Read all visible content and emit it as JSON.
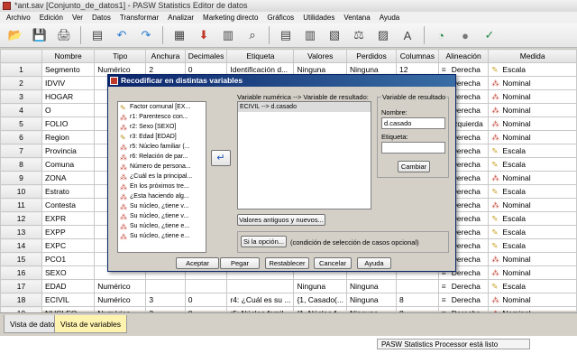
{
  "window": {
    "title": "*ant.sav [Conjunto_de_datos1] - PASW Statistics Editor de datos"
  },
  "menu": [
    "Archivo",
    "Edición",
    "Ver",
    "Datos",
    "Transformar",
    "Analizar",
    "Marketing directo",
    "Gráficos",
    "Utilidades",
    "Ventana",
    "Ayuda"
  ],
  "toolbar_icons": [
    "open-folder-icon",
    "save-icon",
    "print-icon",
    "dialog-recall-icon",
    "undo-icon",
    "redo-icon",
    "goto-case-icon",
    "goto-variable-icon",
    "variables-icon",
    "find-icon",
    "insert-cases-icon",
    "insert-variable-icon",
    "split-file-icon",
    "weight-cases-icon",
    "select-cases-icon",
    "value-labels-icon",
    "use-sets-icon",
    "show-all-variables-icon",
    "spell-check-icon"
  ],
  "columns": [
    "",
    "Nombre",
    "Tipo",
    "Anchura",
    "Decimales",
    "Etiqueta",
    "Valores",
    "Perdidos",
    "Columnas",
    "Alineación",
    "Medida"
  ],
  "rows": [
    {
      "n": "1",
      "name": "Segmento",
      "type": "Numérico",
      "width": "2",
      "dec": "0",
      "label": "Identificación d...",
      "values": "Ninguna",
      "missing": "Ninguna",
      "cols": "12",
      "align": "Derecha",
      "measure": "Escala",
      "mtype": "scale"
    },
    {
      "n": "2",
      "name": "IDVIV",
      "type": "",
      "width": "",
      "dec": "",
      "label": "",
      "values": "",
      "missing": "",
      "cols": "",
      "align": "Derecha",
      "measure": "Nominal",
      "mtype": "nominal"
    },
    {
      "n": "3",
      "name": "HOGAR",
      "type": "",
      "width": "",
      "dec": "",
      "label": "",
      "values": "",
      "missing": "",
      "cols": "",
      "align": "Derecha",
      "measure": "Nominal",
      "mtype": "nominal"
    },
    {
      "n": "4",
      "name": "O",
      "type": "",
      "width": "",
      "dec": "",
      "label": "",
      "values": "",
      "missing": "",
      "cols": "",
      "align": "Derecha",
      "measure": "Nominal",
      "mtype": "nominal"
    },
    {
      "n": "5",
      "name": "FOLIO",
      "type": "",
      "width": "",
      "dec": "",
      "label": "",
      "values": "",
      "missing": "",
      "cols": "",
      "align": "Izquierda",
      "measure": "Nominal",
      "mtype": "nominal"
    },
    {
      "n": "6",
      "name": "Region",
      "type": "",
      "width": "",
      "dec": "",
      "label": "",
      "values": "",
      "missing": "",
      "cols": "",
      "align": "Derecha",
      "measure": "Nominal",
      "mtype": "nominal"
    },
    {
      "n": "7",
      "name": "Provincia",
      "type": "",
      "width": "",
      "dec": "",
      "label": "",
      "values": "",
      "missing": "",
      "cols": "",
      "align": "Derecha",
      "measure": "Escala",
      "mtype": "scale"
    },
    {
      "n": "8",
      "name": "Comuna",
      "type": "",
      "width": "",
      "dec": "",
      "label": "",
      "values": "",
      "missing": "",
      "cols": "",
      "align": "Derecha",
      "measure": "Escala",
      "mtype": "scale"
    },
    {
      "n": "9",
      "name": "ZONA",
      "type": "",
      "width": "",
      "dec": "",
      "label": "",
      "values": "",
      "missing": "",
      "cols": "",
      "align": "Derecha",
      "measure": "Nominal",
      "mtype": "nominal"
    },
    {
      "n": "10",
      "name": "Estrato",
      "type": "",
      "width": "",
      "dec": "",
      "label": "",
      "values": "",
      "missing": "",
      "cols": "",
      "align": "Derecha",
      "measure": "Escala",
      "mtype": "scale"
    },
    {
      "n": "11",
      "name": "Contesta",
      "type": "",
      "width": "",
      "dec": "",
      "label": "",
      "values": "",
      "missing": "",
      "cols": "",
      "align": "Derecha",
      "measure": "Nominal",
      "mtype": "nominal"
    },
    {
      "n": "12",
      "name": "EXPR",
      "type": "",
      "width": "",
      "dec": "",
      "label": "",
      "values": "",
      "missing": "",
      "cols": "",
      "align": "Derecha",
      "measure": "Escala",
      "mtype": "scale"
    },
    {
      "n": "13",
      "name": "EXPP",
      "type": "",
      "width": "",
      "dec": "",
      "label": "",
      "values": "",
      "missing": "",
      "cols": "",
      "align": "Derecha",
      "measure": "Escala",
      "mtype": "scale"
    },
    {
      "n": "14",
      "name": "EXPC",
      "type": "",
      "width": "",
      "dec": "",
      "label": "",
      "values": "",
      "missing": "",
      "cols": "",
      "align": "Derecha",
      "measure": "Escala",
      "mtype": "scale"
    },
    {
      "n": "15",
      "name": "PCO1",
      "type": "",
      "width": "",
      "dec": "",
      "label": "",
      "values": "",
      "missing": "",
      "cols": "",
      "align": "Derecha",
      "measure": "Nominal",
      "mtype": "nominal"
    },
    {
      "n": "16",
      "name": "SEXO",
      "type": "",
      "width": "",
      "dec": "",
      "label": "",
      "values": "",
      "missing": "",
      "cols": "",
      "align": "Derecha",
      "measure": "Nominal",
      "mtype": "nominal"
    },
    {
      "n": "17",
      "name": "EDAD",
      "type": "Numérico",
      "width": "",
      "dec": "",
      "label": "",
      "values": "Ninguna",
      "missing": "Ninguna",
      "cols": "",
      "align": "Derecha",
      "measure": "Escala",
      "mtype": "scale"
    },
    {
      "n": "18",
      "name": "ECIVIL",
      "type": "Numérico",
      "width": "3",
      "dec": "0",
      "label": "r4: ¿Cuál es su ...",
      "values": "{1, Casado(...",
      "missing": "Ninguna",
      "cols": "8",
      "align": "Derecha",
      "measure": "Nominal",
      "mtype": "nominal"
    },
    {
      "n": "19",
      "name": "NUCLEO",
      "type": "Numérico",
      "width": "3",
      "dec": "0",
      "label": "r5: Núcleo famil...",
      "values": "{1, Núcleo f...",
      "missing": "Ninguna",
      "cols": "8",
      "align": "Derecha",
      "measure": "Nominal",
      "mtype": "nominal"
    }
  ],
  "tabs": {
    "data_view": "Vista de datos",
    "variable_view": "Vista de variables"
  },
  "status": "PASW Statistics Processor está listo",
  "dialog": {
    "title": "Recodificar en distintas variables",
    "source_vars": [
      {
        "label": "Factor comunal [EX...",
        "icon": "scale-variable-icon"
      },
      {
        "label": "r1: Parentesco con...",
        "icon": "nominal-variable-icon"
      },
      {
        "label": "r2: Sexo [SEXO]",
        "icon": "nominal-variable-icon"
      },
      {
        "label": "r3: Edad [EDAD]",
        "icon": "scale-variable-icon"
      },
      {
        "label": "r5: Núcleo familiar (...",
        "icon": "nominal-variable-icon"
      },
      {
        "label": "r6: Relación de par...",
        "icon": "nominal-variable-icon"
      },
      {
        "label": "Número de persona...",
        "icon": "nominal-variable-icon"
      },
      {
        "label": "¿Cuál es la principal...",
        "icon": "nominal-variable-icon"
      },
      {
        "label": "En los próximos tre...",
        "icon": "nominal-variable-icon"
      },
      {
        "label": "¿Esta haciendo alg...",
        "icon": "nominal-variable-icon"
      },
      {
        "label": "Su núcleo, ¿tiene v...",
        "icon": "nominal-variable-icon"
      },
      {
        "label": "Su núcleo, ¿tiene v...",
        "icon": "nominal-variable-icon"
      },
      {
        "label": "Su núcleo, ¿tiene e...",
        "icon": "nominal-variable-icon"
      },
      {
        "label": "Su núcleo, ¿tiene e...",
        "icon": "nominal-variable-icon"
      }
    ],
    "mapping_label": "Variable numérica --> Variable de resultado:",
    "mapping_value": "ECIVIL --> d.casado",
    "output_group_label": "Variable de resultado",
    "name_label": "Nombre:",
    "name_value": "d.casado",
    "etiqueta_label": "Etiqueta:",
    "etiqueta_value": "",
    "cambiar": "Cambiar",
    "old_new_button": "Valores antiguos y nuevos...",
    "if_button": "Si la opción...",
    "if_note": "(condición de selección de casos opcional)",
    "buttons": [
      "Aceptar",
      "Pegar",
      "Restablecer",
      "Cancelar",
      "Ayuda"
    ]
  }
}
